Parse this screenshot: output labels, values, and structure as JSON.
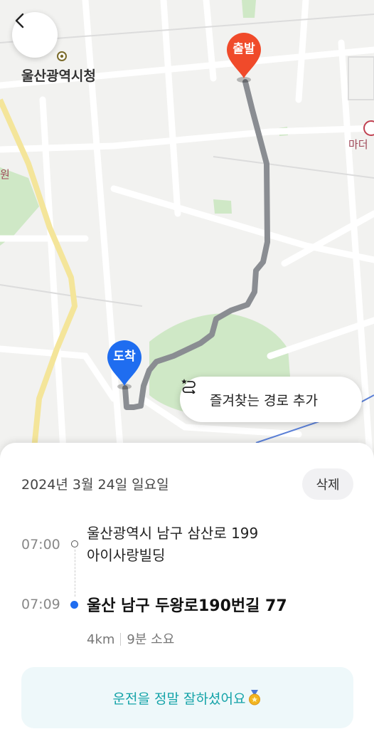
{
  "map": {
    "place_label": "울산광역시청",
    "edge_label_right": "마더",
    "edge_label_left": "원",
    "start_pin": "출발",
    "end_pin": "도착",
    "favorite_button_label": "즐겨찾는 경로 추가"
  },
  "trip": {
    "date": "2024년 3월 24일 일요일",
    "delete_label": "삭제",
    "start_time": "07:00",
    "start_address_line1": "울산광역시 남구 삼산로 199",
    "start_address_line2": "아이사랑빌딩",
    "end_time": "07:09",
    "end_address": "울산 남구 두왕로190번길 77",
    "distance": "4km",
    "duration": "9분 소요",
    "praise_message": "운전을 정말 잘하셨어요"
  },
  "colors": {
    "route": "#8a8d92",
    "start_pin": "#f04a2a",
    "end_pin": "#1f6df0",
    "praise_text": "#14a3a8",
    "medal": "#f2b51f"
  },
  "icons": {
    "back": "chevron-left-icon",
    "favorite_route": "route-star-icon",
    "medal": "medal-icon"
  }
}
